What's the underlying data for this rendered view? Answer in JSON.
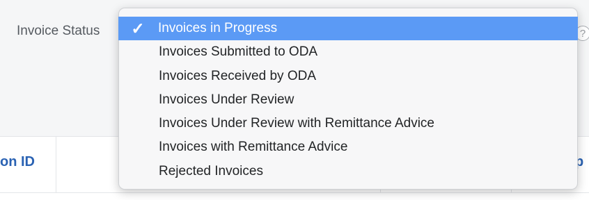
{
  "filter": {
    "label": "Invoice Status",
    "help_icon": "question-circle-icon"
  },
  "dropdown": {
    "check_glyph": "✓",
    "selected_index": 0,
    "options": [
      "Invoices in Progress",
      "Invoices Submitted to ODA",
      "Invoices Received by ODA",
      "Invoices Under Review",
      "Invoices Under Review with Remittance Advice",
      "Invoices with Remittance Advice",
      "Rejected Invoices"
    ]
  },
  "table": {
    "left_header_visible": "on ID",
    "right_header_visible": "p"
  },
  "colors": {
    "selection": "#5b9af5",
    "header_link": "#2a62b3"
  }
}
